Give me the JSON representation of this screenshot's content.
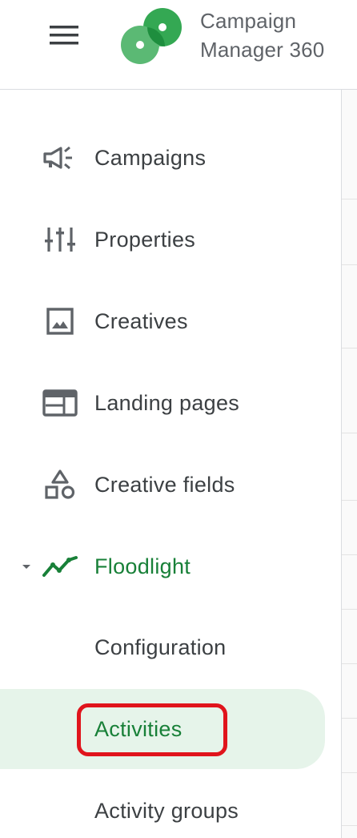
{
  "header": {
    "menu_icon": "hamburger-menu-icon",
    "logo_icon": "campaign-manager-logo",
    "product_name_line1": "Campaign",
    "product_name_line2": "Manager 360"
  },
  "sidebar": {
    "items": [
      {
        "label": "Campaigns",
        "icon": "megaphone-icon"
      },
      {
        "label": "Properties",
        "icon": "sliders-icon"
      },
      {
        "label": "Creatives",
        "icon": "image-icon"
      },
      {
        "label": "Landing pages",
        "icon": "web-page-icon"
      },
      {
        "label": "Creative fields",
        "icon": "shapes-icon"
      },
      {
        "label": "Floodlight",
        "icon": "trending-line-icon",
        "expanded": true
      }
    ],
    "floodlight_children": [
      {
        "label": "Configuration"
      },
      {
        "label": "Activities",
        "selected": true
      },
      {
        "label": "Activity groups"
      }
    ]
  },
  "colors": {
    "accent_green": "#188038",
    "selected_bg": "#e6f4ea",
    "highlight_red": "#e0141c",
    "text": "#3c4043",
    "icon": "#5f6368"
  }
}
